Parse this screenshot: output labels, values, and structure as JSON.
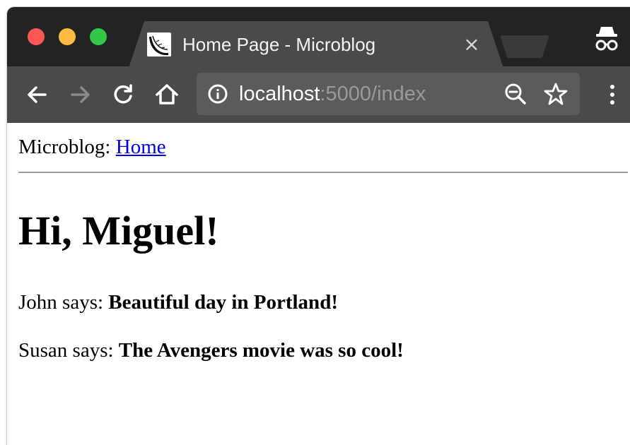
{
  "browser": {
    "tab": {
      "title": "Home Page - Microblog",
      "favicon": "flask-icon",
      "close": "×"
    },
    "toolbar": {
      "back": "arrow-left-icon",
      "forward": "arrow-right-icon",
      "reload": "reload-icon",
      "home": "home-icon",
      "info": "info-icon",
      "zoom": "zoom-icon",
      "bookmark": "star-icon",
      "menu": "menu-dots-icon"
    },
    "url": {
      "host": "localhost",
      "path": ":5000/index"
    },
    "mode": "incognito-icon"
  },
  "page": {
    "nav": {
      "brand": "Microblog:",
      "home_link": "Home"
    },
    "greeting": "Hi, Miguel!",
    "posts": [
      {
        "author": "John says:",
        "body": "Beautiful day in Portland!"
      },
      {
        "author": "Susan says:",
        "body": "The Avengers movie was so cool!"
      }
    ]
  },
  "colors": {
    "tabstrip": "#232323",
    "toolbar": "#4a4a4a",
    "omnibox": "#5b5b5b",
    "link": "#0000ee",
    "close": "#fc5753",
    "minimize": "#fdbc40",
    "maximize": "#33c748"
  }
}
